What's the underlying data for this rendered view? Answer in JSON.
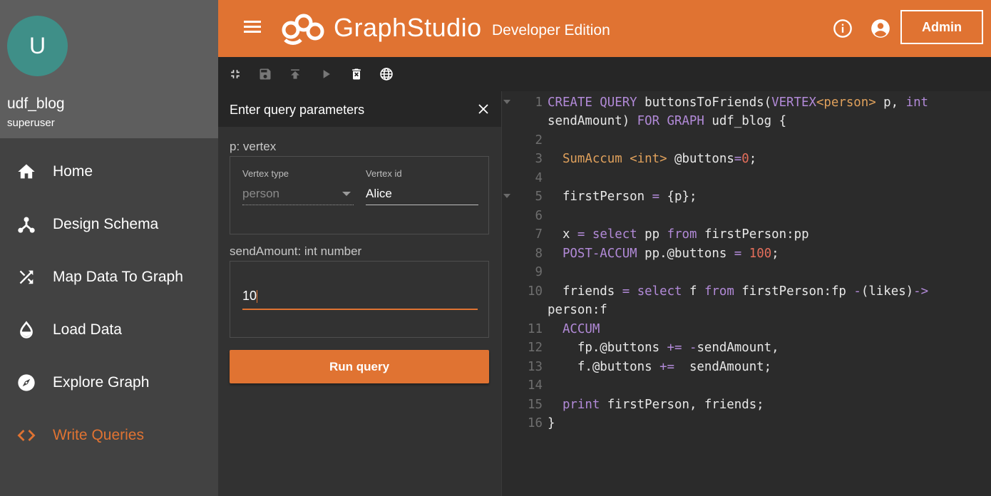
{
  "sidebar": {
    "avatar_letter": "U",
    "username": "udf_blog",
    "role": "superuser",
    "items": [
      {
        "label": "Home",
        "icon": "home-icon"
      },
      {
        "label": "Design Schema",
        "icon": "schema-icon"
      },
      {
        "label": "Map Data To Graph",
        "icon": "shuffle-icon"
      },
      {
        "label": "Load Data",
        "icon": "drop-icon"
      },
      {
        "label": "Explore Graph",
        "icon": "compass-icon"
      },
      {
        "label": "Write Queries",
        "icon": "code-icon",
        "active": true
      }
    ]
  },
  "header": {
    "brand_part1": "Graph",
    "brand_part2": "Studio",
    "edition": "Developer Edition",
    "admin_label": "Admin",
    "accent_color": "#e07332"
  },
  "params_panel": {
    "title": "Enter query parameters",
    "p_label": "p: vertex",
    "vertex_type_label": "Vertex type",
    "vertex_type_value": "person",
    "vertex_id_label": "Vertex id",
    "vertex_id_value": "Alice",
    "send_label": "sendAmount: int number",
    "send_value": "10",
    "run_label": "Run query"
  },
  "editor": {
    "lines": [
      {
        "n": "1",
        "fold": true
      },
      {
        "n": "",
        "fold": false
      },
      {
        "n": "2"
      },
      {
        "n": "3"
      },
      {
        "n": "4"
      },
      {
        "n": "5",
        "fold": true
      },
      {
        "n": "6"
      },
      {
        "n": "7"
      },
      {
        "n": "8"
      },
      {
        "n": "9"
      },
      {
        "n": "10"
      },
      {
        "n": ""
      },
      {
        "n": "11"
      },
      {
        "n": "12"
      },
      {
        "n": "13"
      },
      {
        "n": "14"
      },
      {
        "n": "15"
      },
      {
        "n": "16"
      }
    ],
    "tokens": {
      "l1": [
        "CREATE QUERY",
        " buttonsToFriends(",
        "VERTEX",
        "<person>",
        " p, ",
        "int"
      ],
      "l1b": [
        "sendAmount) ",
        "FOR GRAPH",
        " udf_blog {"
      ],
      "l3": [
        "SumAccum",
        " ",
        "<int>",
        " @buttons",
        "=",
        "0",
        ";"
      ],
      "l5": [
        "firstPerson ",
        "=",
        " {p};"
      ],
      "l7": [
        "x ",
        "=",
        " ",
        "select",
        " pp ",
        "from",
        " firstPerson:pp"
      ],
      "l8": [
        "POST-ACCUM",
        " pp.@buttons ",
        "=",
        " ",
        "100",
        ";"
      ],
      "l10": [
        "friends ",
        "=",
        " ",
        "select",
        " f ",
        "from",
        " firstPerson:fp ",
        "-",
        "(likes)",
        "->"
      ],
      "l10b": [
        "person:f"
      ],
      "l11": [
        "ACCUM"
      ],
      "l12": [
        "fp.@buttons ",
        "+=",
        " ",
        "-",
        "sendAmount,"
      ],
      "l13": [
        "f.@buttons ",
        "+=",
        "  sendAmount;"
      ],
      "l15": [
        "print",
        " firstPerson, friends;"
      ],
      "l16": [
        "}"
      ]
    }
  }
}
